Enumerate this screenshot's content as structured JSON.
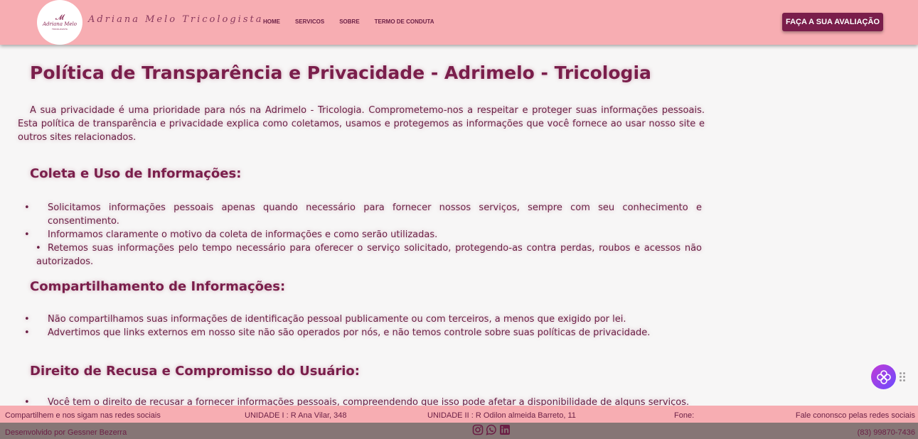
{
  "header": {
    "brand": "Adriana Melo Tricologista",
    "logo": {
      "name": "Adriana Melo",
      "subtitle": "TRICOLOGISTA"
    },
    "nav": [
      "HOME",
      "SERVICOS",
      "SOBRE",
      "TERMO DE CONDUTA"
    ],
    "cta_label": "FAÇA A SUA AVALIAÇÃO"
  },
  "content": {
    "title": "Política de Transparência e Privacidade - Adrimelo - Tricologia",
    "intro": "A sua privacidade é uma prioridade para nós na Adrimelo - Tricologia. Comprometemo-nos a respeitar e proteger suas informações pessoais. Esta política de transparência e privacidade explica como coletamos, usamos e protegemos as informações que você fornece ao usar nosso site e outros sites relacionados.",
    "sections": [
      {
        "heading": "Coleta e Uso de Informações:",
        "items": [
          "Solicitamos informações pessoais apenas quando necessário para fornecer nossos serviços, sempre com seu conhecimento e consentimento.",
          "Informamos claramente o motivo da coleta de informações e como serão utilizadas.",
          "Retemos suas informações pelo tempo necessário para oferecer o serviço solicitado, protegendo-as contra perdas, roubos e acessos não autorizados."
        ]
      },
      {
        "heading": "Compartilhamento de Informações:",
        "items": [
          "Não compartilhamos suas informações de identificação pessoal publicamente ou com terceiros, a menos que exigido por lei.",
          "Advertimos que links externos em nosso site não são operados por nós, e não temos controle sobre suas políticas de privacidade."
        ]
      },
      {
        "heading": "Direito de Recusa e Compromisso do Usuário:",
        "items": [
          "Você tem o direito de recusar a fornecer informações pessoais, compreendendo que isso pode afetar a disponibilidade de alguns serviços."
        ]
      }
    ]
  },
  "footer": {
    "follow": "Compartilhem e nos sigam nas redes sociais",
    "unit1": "UNIDADE I : R Ana Vilar, 348",
    "unit2": "UNIDADE II : R Odilon almeida Barreto, 11",
    "phone_label": "Fone:",
    "contact": "Fale cononsco pelas redes sociais",
    "developer": "Desenvolvido por Gessner Bezerra",
    "phone": "(83) 99870-7436",
    "socials": [
      "instagram-icon",
      "whatsapp-icon",
      "linkedin-icon"
    ]
  },
  "colors": {
    "header_bg": "#f7adb2",
    "accent": "#7a1e4b",
    "footer_dark": "#867676"
  }
}
